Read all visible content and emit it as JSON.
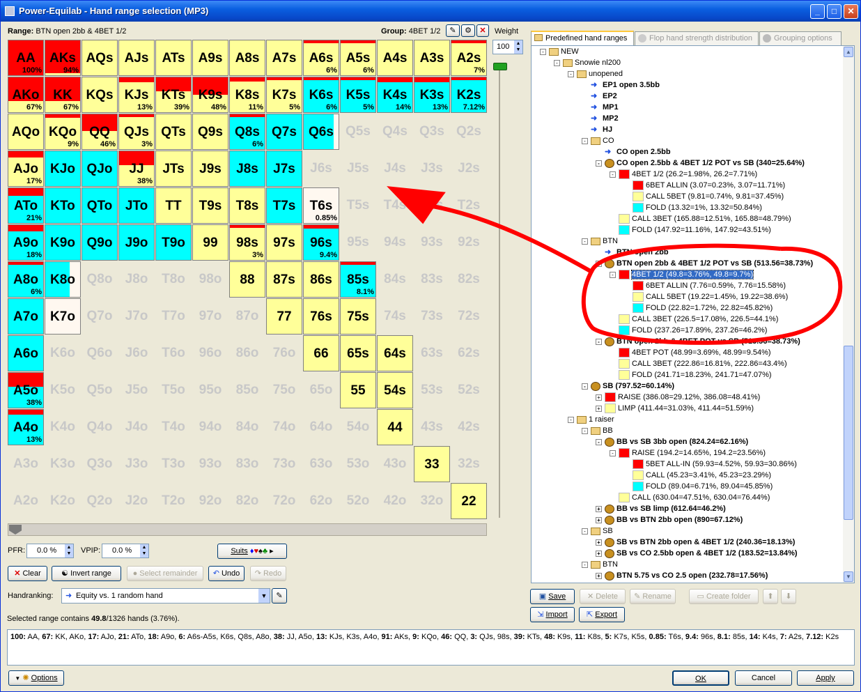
{
  "window": {
    "title": "Power-Equilab - Hand range selection (MP3)"
  },
  "range_label": "Range:",
  "range_name": "BTN open 2bb & 4BET 1/2",
  "group_label": "Group:",
  "group_name": "4BET 1/2",
  "weight_label": "Weight",
  "weight_value": "100",
  "colors": {
    "red": "#ff0000",
    "yellow": "#ffff99",
    "cyan": "#00ffff",
    "offwhite": "#fff8f0"
  },
  "grid": [
    [
      {
        "n": "AA",
        "c": "r",
        "p": "100%"
      },
      {
        "n": "AKs",
        "c": "r",
        "r": 0.94,
        "p": "94%"
      },
      {
        "n": "AQs",
        "c": "y"
      },
      {
        "n": "AJs",
        "c": "y"
      },
      {
        "n": "ATs",
        "c": "y"
      },
      {
        "n": "A9s",
        "c": "y"
      },
      {
        "n": "A8s",
        "c": "y"
      },
      {
        "n": "A7s",
        "c": "y"
      },
      {
        "n": "A6s",
        "c": "y",
        "r": 0.06,
        "p": "6%"
      },
      {
        "n": "A5s",
        "c": "y",
        "r": 0.06,
        "p": "6%"
      },
      {
        "n": "A4s",
        "c": "y"
      },
      {
        "n": "A3s",
        "c": "y"
      },
      {
        "n": "A2s",
        "c": "y",
        "r": 0.07,
        "p": "7%"
      }
    ],
    [
      {
        "n": "AKo",
        "c": "r",
        "r": 0.67,
        "p": "67%"
      },
      {
        "n": "KK",
        "c": "r",
        "r": 0.67,
        "p": "67%"
      },
      {
        "n": "KQs",
        "c": "y"
      },
      {
        "n": "KJs",
        "c": "y",
        "r": 0.13,
        "p": "13%"
      },
      {
        "n": "KTs",
        "c": "y",
        "r": 0.39,
        "p": "39%"
      },
      {
        "n": "K9s",
        "c": "y",
        "r": 0.48,
        "p": "48%"
      },
      {
        "n": "K8s",
        "c": "y",
        "r": 0.11,
        "p": "11%"
      },
      {
        "n": "K7s",
        "c": "y",
        "r": 0.05,
        "p": "5%"
      },
      {
        "n": "K6s",
        "c": "cy",
        "r": 0.06,
        "p": "6%"
      },
      {
        "n": "K5s",
        "c": "cy",
        "r": 0.05,
        "p": "5%"
      },
      {
        "n": "K4s",
        "c": "cy",
        "r": 0.14,
        "p": "14%"
      },
      {
        "n": "K3s",
        "c": "cy",
        "r": 0.13,
        "p": "13%"
      },
      {
        "n": "K2s",
        "c": "cy",
        "r": 0.07,
        "p": "7.12%"
      }
    ],
    [
      {
        "n": "AQo",
        "c": "y"
      },
      {
        "n": "KQo",
        "c": "y",
        "r": 0.09,
        "p": "9%"
      },
      {
        "n": "QQ",
        "c": "y",
        "r": 0.46,
        "p": "46%"
      },
      {
        "n": "QJs",
        "c": "y",
        "r": 0.03,
        "p": "3%"
      },
      {
        "n": "QTs",
        "c": "y"
      },
      {
        "n": "Q9s",
        "c": "y"
      },
      {
        "n": "Q8s",
        "c": "cy",
        "r": 0.06,
        "p": "6%"
      },
      {
        "n": "Q7s",
        "c": "cy"
      },
      {
        "n": "Q6s",
        "c": "cp",
        "f": 0.85
      },
      {
        "n": "Q5s",
        "c": "x"
      },
      {
        "n": "Q4s",
        "c": "x"
      },
      {
        "n": "Q3s",
        "c": "x"
      },
      {
        "n": "Q2s",
        "c": "x"
      }
    ],
    [
      {
        "n": "AJo",
        "c": "y",
        "r": 0.17,
        "p": "17%"
      },
      {
        "n": "KJo",
        "c": "cy"
      },
      {
        "n": "QJo",
        "c": "cy"
      },
      {
        "n": "JJ",
        "c": "y",
        "r": 0.38,
        "p": "38%"
      },
      {
        "n": "JTs",
        "c": "y"
      },
      {
        "n": "J9s",
        "c": "y"
      },
      {
        "n": "J8s",
        "c": "cy"
      },
      {
        "n": "J7s",
        "c": "cy"
      },
      {
        "n": "J6s",
        "c": "x"
      },
      {
        "n": "J5s",
        "c": "x"
      },
      {
        "n": "J4s",
        "c": "x"
      },
      {
        "n": "J3s",
        "c": "x"
      },
      {
        "n": "J2s",
        "c": "x"
      }
    ],
    [
      {
        "n": "ATo",
        "c": "cy",
        "r": 0.21,
        "p": "21%"
      },
      {
        "n": "KTo",
        "c": "cy"
      },
      {
        "n": "QTo",
        "c": "cy"
      },
      {
        "n": "JTo",
        "c": "cy"
      },
      {
        "n": "TT",
        "c": "y"
      },
      {
        "n": "T9s",
        "c": "y"
      },
      {
        "n": "T8s",
        "c": "y"
      },
      {
        "n": "T7s",
        "c": "cy"
      },
      {
        "n": "T6s",
        "c": "w",
        "p": "0.85%"
      },
      {
        "n": "T5s",
        "c": "x"
      },
      {
        "n": "T4s",
        "c": "x"
      },
      {
        "n": "T3s",
        "c": "x"
      },
      {
        "n": "T2s",
        "c": "x"
      }
    ],
    [
      {
        "n": "A9o",
        "c": "cy",
        "r": 0.18,
        "p": "18%"
      },
      {
        "n": "K9o",
        "c": "cy"
      },
      {
        "n": "Q9o",
        "c": "cy"
      },
      {
        "n": "J9o",
        "c": "cy"
      },
      {
        "n": "T9o",
        "c": "cy"
      },
      {
        "n": "99",
        "c": "y"
      },
      {
        "n": "98s",
        "c": "y",
        "r": 0.03,
        "p": "3%"
      },
      {
        "n": "97s",
        "c": "y"
      },
      {
        "n": "96s",
        "c": "cy",
        "r": 0.09,
        "p": "9.4%"
      },
      {
        "n": "95s",
        "c": "x"
      },
      {
        "n": "94s",
        "c": "x"
      },
      {
        "n": "93s",
        "c": "x"
      },
      {
        "n": "92s",
        "c": "x"
      }
    ],
    [
      {
        "n": "A8o",
        "c": "cy",
        "r": 0.06,
        "p": "6%"
      },
      {
        "n": "K8o",
        "c": "cp",
        "f": 0.7
      },
      {
        "n": "Q8o",
        "c": "x"
      },
      {
        "n": "J8o",
        "c": "x"
      },
      {
        "n": "T8o",
        "c": "x"
      },
      {
        "n": "98o",
        "c": "x"
      },
      {
        "n": "88",
        "c": "y"
      },
      {
        "n": "87s",
        "c": "y"
      },
      {
        "n": "86s",
        "c": "y"
      },
      {
        "n": "85s",
        "c": "cy",
        "r": 0.08,
        "p": "8.1%"
      },
      {
        "n": "84s",
        "c": "x"
      },
      {
        "n": "83s",
        "c": "x"
      },
      {
        "n": "82s",
        "c": "x"
      }
    ],
    [
      {
        "n": "A7o",
        "c": "cy"
      },
      {
        "n": "K7o",
        "c": "w"
      },
      {
        "n": "Q7o",
        "c": "x"
      },
      {
        "n": "J7o",
        "c": "x"
      },
      {
        "n": "T7o",
        "c": "x"
      },
      {
        "n": "97o",
        "c": "x"
      },
      {
        "n": "87o",
        "c": "x"
      },
      {
        "n": "77",
        "c": "y"
      },
      {
        "n": "76s",
        "c": "y"
      },
      {
        "n": "75s",
        "c": "y"
      },
      {
        "n": "74s",
        "c": "x"
      },
      {
        "n": "73s",
        "c": "x"
      },
      {
        "n": "72s",
        "c": "x"
      }
    ],
    [
      {
        "n": "A6o",
        "c": "cy"
      },
      {
        "n": "K6o",
        "c": "x"
      },
      {
        "n": "Q6o",
        "c": "x"
      },
      {
        "n": "J6o",
        "c": "x"
      },
      {
        "n": "T6o",
        "c": "x"
      },
      {
        "n": "96o",
        "c": "x"
      },
      {
        "n": "86o",
        "c": "x"
      },
      {
        "n": "76o",
        "c": "x"
      },
      {
        "n": "66",
        "c": "y"
      },
      {
        "n": "65s",
        "c": "y"
      },
      {
        "n": "64s",
        "c": "y"
      },
      {
        "n": "63s",
        "c": "x"
      },
      {
        "n": "62s",
        "c": "x"
      }
    ],
    [
      {
        "n": "A5o",
        "c": "cy",
        "r": 0.38,
        "p": "38%"
      },
      {
        "n": "K5o",
        "c": "x"
      },
      {
        "n": "Q5o",
        "c": "x"
      },
      {
        "n": "J5o",
        "c": "x"
      },
      {
        "n": "T5o",
        "c": "x"
      },
      {
        "n": "95o",
        "c": "x"
      },
      {
        "n": "85o",
        "c": "x"
      },
      {
        "n": "75o",
        "c": "x"
      },
      {
        "n": "65o",
        "c": "x"
      },
      {
        "n": "55",
        "c": "y"
      },
      {
        "n": "54s",
        "c": "y"
      },
      {
        "n": "53s",
        "c": "x"
      },
      {
        "n": "52s",
        "c": "x"
      }
    ],
    [
      {
        "n": "A4o",
        "c": "cy",
        "r": 0.13,
        "p": "13%"
      },
      {
        "n": "K4o",
        "c": "x"
      },
      {
        "n": "Q4o",
        "c": "x"
      },
      {
        "n": "J4o",
        "c": "x"
      },
      {
        "n": "T4o",
        "c": "x"
      },
      {
        "n": "94o",
        "c": "x"
      },
      {
        "n": "84o",
        "c": "x"
      },
      {
        "n": "74o",
        "c": "x"
      },
      {
        "n": "64o",
        "c": "x"
      },
      {
        "n": "54o",
        "c": "x"
      },
      {
        "n": "44",
        "c": "y"
      },
      {
        "n": "43s",
        "c": "x"
      },
      {
        "n": "42s",
        "c": "x"
      }
    ],
    [
      {
        "n": "A3o",
        "c": "x"
      },
      {
        "n": "K3o",
        "c": "x"
      },
      {
        "n": "Q3o",
        "c": "x"
      },
      {
        "n": "J3o",
        "c": "x"
      },
      {
        "n": "T3o",
        "c": "x"
      },
      {
        "n": "93o",
        "c": "x"
      },
      {
        "n": "83o",
        "c": "x"
      },
      {
        "n": "73o",
        "c": "x"
      },
      {
        "n": "63o",
        "c": "x"
      },
      {
        "n": "53o",
        "c": "x"
      },
      {
        "n": "43o",
        "c": "x"
      },
      {
        "n": "33",
        "c": "y"
      },
      {
        "n": "32s",
        "c": "x"
      }
    ],
    [
      {
        "n": "A2o",
        "c": "x"
      },
      {
        "n": "K2o",
        "c": "x"
      },
      {
        "n": "Q2o",
        "c": "x"
      },
      {
        "n": "J2o",
        "c": "x"
      },
      {
        "n": "T2o",
        "c": "x"
      },
      {
        "n": "92o",
        "c": "x"
      },
      {
        "n": "82o",
        "c": "x"
      },
      {
        "n": "72o",
        "c": "x"
      },
      {
        "n": "62o",
        "c": "x"
      },
      {
        "n": "52o",
        "c": "x"
      },
      {
        "n": "42o",
        "c": "x"
      },
      {
        "n": "32o",
        "c": "x"
      },
      {
        "n": "22",
        "c": "y"
      }
    ]
  ],
  "pfr_label": "PFR:",
  "pfr_value": "0.0 %",
  "vpip_label": "VPIP:",
  "vpip_value": "0.0 %",
  "suits_label": "Suits",
  "buttons": {
    "clear": "Clear",
    "invert": "Invert range",
    "select_remainder": "Select remainder",
    "undo": "Undo",
    "redo": "Redo",
    "options": "Options",
    "ok": "OK",
    "cancel": "Cancel",
    "apply": "Apply",
    "save": "Save",
    "delete": "Delete",
    "rename": "Rename",
    "create_folder": "Create folder",
    "import": "Import",
    "export": "Export"
  },
  "handranking_label": "Handranking:",
  "handranking_value": "Equity vs. 1 random hand",
  "selected_pre": "Selected range contains ",
  "selected_bold": "49.8",
  "selected_post": "/1326 hands (3.76%).",
  "summary": [
    [
      "100:",
      " AA, "
    ],
    [
      "67:",
      " KK, AKo, "
    ],
    [
      "17:",
      " AJo, "
    ],
    [
      "21:",
      " ATo, "
    ],
    [
      "18:",
      " A9o, "
    ],
    [
      "6:",
      " A6s-A5s, K6s, Q8s, A8o, "
    ],
    [
      "38:",
      " JJ, A5o, "
    ],
    [
      "13:",
      " KJs, K3s, A4o, "
    ],
    [
      "91:",
      " AKs, "
    ],
    [
      "9:",
      " KQo, "
    ],
    [
      "46:",
      " QQ, "
    ],
    [
      "3:",
      " QJs, 98s, "
    ],
    [
      "39:",
      " KTs, "
    ],
    [
      "48:",
      " K9s, "
    ],
    [
      "11:",
      " K8s, "
    ],
    [
      "5:",
      " K7s, K5s, "
    ],
    [
      "0.85:",
      " T6s, "
    ],
    [
      "9.4:",
      " 96s, "
    ],
    [
      "8.1:",
      " 85s, "
    ],
    [
      "14:",
      " K4s, "
    ],
    [
      "7:",
      " A2s, "
    ],
    [
      "7.12:",
      " K2s"
    ]
  ],
  "tabs": [
    "Predefined hand ranges",
    "Flop hand strength distribution",
    "Grouping options"
  ],
  "tree": [
    {
      "l": 1,
      "i": "fo",
      "t": "NEW",
      "x": "-"
    },
    {
      "l": 2,
      "i": "fo",
      "t": "Snowie nl200",
      "x": "-"
    },
    {
      "l": 3,
      "i": "fo",
      "t": "unopened",
      "x": "-"
    },
    {
      "l": 4,
      "i": "ar",
      "t": "EP1 open 3.5bb",
      "b": 1
    },
    {
      "l": 4,
      "i": "ar",
      "t": "EP2",
      "b": 1
    },
    {
      "l": 4,
      "i": "ar",
      "t": "MP1",
      "b": 1
    },
    {
      "l": 4,
      "i": "ar",
      "t": "MP2",
      "b": 1
    },
    {
      "l": 4,
      "i": "ar",
      "t": "HJ",
      "b": 1
    },
    {
      "l": 4,
      "i": "fo",
      "t": "CO",
      "x": "-"
    },
    {
      "l": 5,
      "i": "ar",
      "t": "CO open 2.5bb",
      "b": 1
    },
    {
      "l": 5,
      "i": "pp",
      "t": "CO open 2.5bb & 4BET 1/2 POT vs SB (340=25.64%)",
      "b": 1,
      "x": "-"
    },
    {
      "l": 6,
      "i": "r",
      "t": "4BET 1/2 (26.2=1.98%, 26.2=7.71%)",
      "x": "-"
    },
    {
      "l": 7,
      "i": "r",
      "t": "6BET ALLIN (3.07=0.23%, 3.07=11.71%)"
    },
    {
      "l": 7,
      "i": "y",
      "t": "CALL 5BET (9.81=0.74%, 9.81=37.45%)"
    },
    {
      "l": 7,
      "i": "c",
      "t": "FOLD (13.32=1%, 13.32=50.84%)"
    },
    {
      "l": 6,
      "i": "y",
      "t": "CALL 3BET (165.88=12.51%, 165.88=48.79%)"
    },
    {
      "l": 6,
      "i": "c",
      "t": "FOLD (147.92=11.16%, 147.92=43.51%)"
    },
    {
      "l": 4,
      "i": "fo",
      "t": "BTN",
      "x": "-"
    },
    {
      "l": 5,
      "i": "ar",
      "t": "BTN open 2bb",
      "b": 1
    },
    {
      "l": 5,
      "i": "pp",
      "t": "BTN open 2bb & 4BET 1/2 POT vs SB (513.56=38.73%)",
      "b": 1,
      "x": "-"
    },
    {
      "l": 6,
      "i": "r",
      "t": "4BET 1/2 (49.8=3.76%, 49.8=9.7%)",
      "x": "-",
      "s": 1
    },
    {
      "l": 7,
      "i": "r",
      "t": "6BET ALLIN (7.76=0.59%, 7.76=15.58%)"
    },
    {
      "l": 7,
      "i": "y",
      "t": "CALL 5BET (19.22=1.45%, 19.22=38.6%)"
    },
    {
      "l": 7,
      "i": "c",
      "t": "FOLD (22.82=1.72%, 22.82=45.82%)"
    },
    {
      "l": 6,
      "i": "y",
      "t": "CALL 3BET (226.5=17.08%, 226.5=44.1%)"
    },
    {
      "l": 6,
      "i": "c",
      "t": "FOLD (237.26=17.89%, 237.26=46.2%)"
    },
    {
      "l": 5,
      "i": "pp",
      "t": "BTN open 2bb & 4BET POT vs SB (513.56=38.73%)",
      "b": 1,
      "x": "-"
    },
    {
      "l": 6,
      "i": "r",
      "t": "4BET POT (48.99=3.69%, 48.99=9.54%)"
    },
    {
      "l": 6,
      "i": "y",
      "t": "CALL 3BET (222.86=16.81%, 222.86=43.4%)"
    },
    {
      "l": 6,
      "i": "y",
      "t": "FOLD (241.71=18.23%, 241.71=47.07%)"
    },
    {
      "l": 4,
      "i": "pp",
      "t": "SB (797.52=60.14%)",
      "b": 1,
      "x": "-"
    },
    {
      "l": 5,
      "i": "r",
      "t": "RAISE (386.08=29.12%, 386.08=48.41%)",
      "x": "+"
    },
    {
      "l": 5,
      "i": "y",
      "t": "LIMP (411.44=31.03%, 411.44=51.59%)",
      "x": "+"
    },
    {
      "l": 3,
      "i": "fo",
      "t": "1 raiser",
      "x": "-"
    },
    {
      "l": 4,
      "i": "fo",
      "t": "BB",
      "x": "-"
    },
    {
      "l": 5,
      "i": "pp",
      "t": "BB vs SB 3bb open (824.24=62.16%)",
      "b": 1,
      "x": "-"
    },
    {
      "l": 6,
      "i": "r",
      "t": "RAISE (194.2=14.65%, 194.2=23.56%)",
      "x": "-"
    },
    {
      "l": 7,
      "i": "r",
      "t": "5BET ALL-IN (59.93=4.52%, 59.93=30.86%)"
    },
    {
      "l": 7,
      "i": "y",
      "t": "CALL (45.23=3.41%, 45.23=23.29%)"
    },
    {
      "l": 7,
      "i": "c",
      "t": "FOLD (89.04=6.71%, 89.04=45.85%)"
    },
    {
      "l": 6,
      "i": "y",
      "t": "CALL (630.04=47.51%, 630.04=76.44%)"
    },
    {
      "l": 5,
      "i": "pp",
      "t": "BB vs SB limp (612.64=46.2%)",
      "b": 1,
      "x": "+"
    },
    {
      "l": 5,
      "i": "pp",
      "t": "BB vs BTN 2bb open (890=67.12%)",
      "b": 1,
      "x": "+"
    },
    {
      "l": 4,
      "i": "fo",
      "t": "SB",
      "x": "-"
    },
    {
      "l": 5,
      "i": "pp",
      "t": "SB vs BTN 2bb open & 4BET 1/2 (240.36=18.13%)",
      "b": 1,
      "x": "+"
    },
    {
      "l": 5,
      "i": "pp",
      "t": "SB vs CO 2.5bb open & 4BET 1/2 (183.52=13.84%)",
      "b": 1,
      "x": "+"
    },
    {
      "l": 4,
      "i": "fo",
      "t": "BTN",
      "x": "-"
    },
    {
      "l": 5,
      "i": "pp",
      "t": "BTN 5.75 vs CO 2.5 open (232.78=17.56%)",
      "b": 1,
      "x": "+"
    }
  ]
}
